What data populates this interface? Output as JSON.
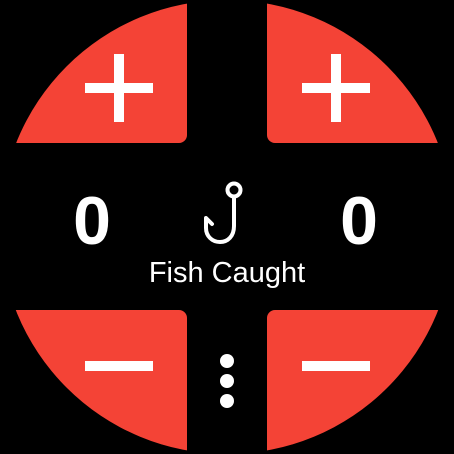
{
  "colors": {
    "accent": "#f44336",
    "background": "#000000",
    "foreground": "#ffffff"
  },
  "left_counter": {
    "value": "0",
    "increment_icon": "plus-icon",
    "decrement_icon": "minus-icon"
  },
  "right_counter": {
    "value": "0",
    "increment_icon": "plus-icon",
    "decrement_icon": "minus-icon"
  },
  "center": {
    "icon": "fish-hook-icon",
    "label": "Fish Caught"
  },
  "menu": {
    "icon": "more-vertical-icon"
  }
}
